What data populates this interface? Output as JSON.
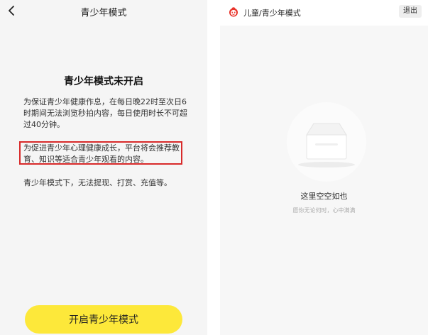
{
  "left": {
    "header_title": "青少年模式",
    "status_title": "青少年模式未开启",
    "paragraph_1": "为保证青少年健康作息，在每日晚22时至次日6时期间无法浏览秒拍内容，每日使用时长不可超过40分钟。",
    "paragraph_2": "为促进青少年心理健康成长，平台将会推荐教育、知识等适合青少年观看的内容。",
    "paragraph_3": "青少年模式下，无法提现、打赏、充值等。",
    "enable_button": "开启青少年模式",
    "back_icon": "chevron-left-icon"
  },
  "right": {
    "header_title": "儿童/青少年模式",
    "exit_button": "退出",
    "empty_title": "这里空空如也",
    "empty_subtitle": "愿你无论何时，心中满满",
    "brand_icon": "red-face-icon"
  },
  "colors": {
    "accent_yellow": "#fde83a",
    "highlight_red": "#d82a2a",
    "brand_red": "#e8332a"
  }
}
